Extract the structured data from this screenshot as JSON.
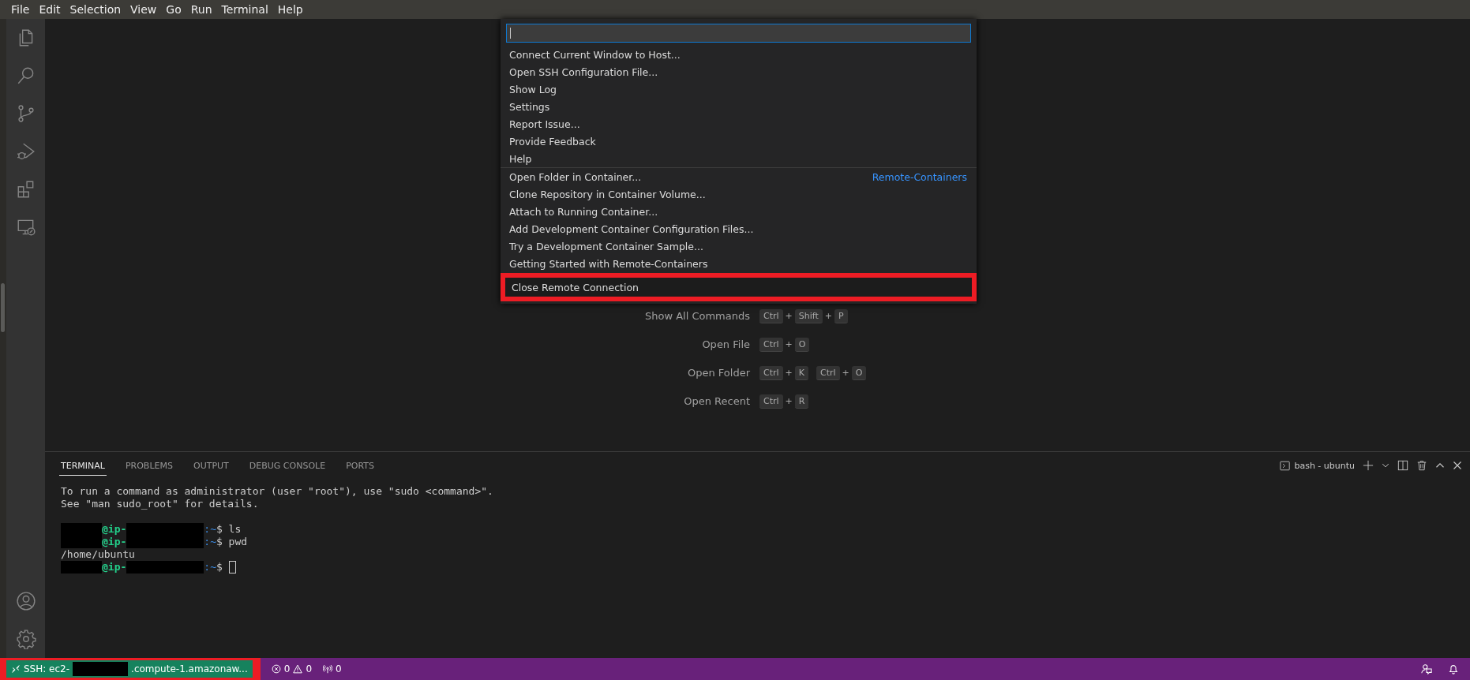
{
  "menu_bar": [
    "File",
    "Edit",
    "Selection",
    "View",
    "Go",
    "Run",
    "Terminal",
    "Help"
  ],
  "activity_bar": {
    "top": [
      {
        "kind": "files",
        "selected": false
      },
      {
        "kind": "search",
        "selected": false
      },
      {
        "kind": "source-control",
        "selected": false
      },
      {
        "kind": "run-debug",
        "selected": false
      },
      {
        "kind": "extensions",
        "selected": false
      },
      {
        "kind": "remote",
        "selected": false
      }
    ],
    "bottom": [
      {
        "kind": "account"
      },
      {
        "kind": "settings"
      }
    ]
  },
  "welcome_shortcuts": [
    {
      "label": "Show All Commands",
      "keys": [
        [
          "Ctrl",
          "Shift",
          "P"
        ]
      ]
    },
    {
      "label": "Open File",
      "keys": [
        [
          "Ctrl",
          "O"
        ]
      ]
    },
    {
      "label": "Open Folder",
      "keys": [
        [
          "Ctrl",
          "K"
        ],
        [
          "Ctrl",
          "O"
        ]
      ]
    },
    {
      "label": "Open Recent",
      "keys": [
        [
          "Ctrl",
          "R"
        ]
      ]
    }
  ],
  "key_joiner": "+",
  "quick_pick": {
    "focused": true,
    "groups": [
      {
        "items": [
          {
            "label": "Connect Current Window to Host...",
            "highlighted": false
          },
          {
            "label": "Open SSH Configuration File...",
            "highlighted": false
          },
          {
            "label": "Show Log",
            "highlighted": false
          },
          {
            "label": "Settings",
            "highlighted": false
          },
          {
            "label": "Report Issue...",
            "highlighted": false
          },
          {
            "label": "Provide Feedback",
            "highlighted": false
          },
          {
            "label": "Help",
            "highlighted": false
          }
        ]
      },
      {
        "label": "Remote-Containers",
        "items": [
          {
            "label": "Open Folder in Container...",
            "highlighted": false
          },
          {
            "label": "Clone Repository in Container Volume...",
            "highlighted": false
          },
          {
            "label": "Attach to Running Container...",
            "highlighted": false
          },
          {
            "label": "Add Development Container Configuration Files...",
            "highlighted": false
          },
          {
            "label": "Try a Development Container Sample...",
            "highlighted": false
          },
          {
            "label": "Getting Started with Remote-Containers",
            "highlighted": false
          },
          {
            "label": "Close Remote Connection",
            "highlighted": true
          }
        ]
      }
    ]
  },
  "panel": {
    "tabs": [
      {
        "label": "TERMINAL",
        "selected": true
      },
      {
        "label": "PROBLEMS",
        "selected": false
      },
      {
        "label": "OUTPUT",
        "selected": false
      },
      {
        "label": "DEBUG CONSOLE",
        "selected": false
      },
      {
        "label": "PORTS",
        "selected": false
      }
    ],
    "terminal_name": "bash - ubuntu",
    "terminal_lines": [
      {
        "kind": "text",
        "text": "To run a command as administrator (user \"root\"), use \"sudo <command>\"."
      },
      {
        "kind": "text",
        "text": "See \"man sudo_root\" for details."
      },
      {
        "kind": "blank"
      },
      {
        "kind": "prompt",
        "host": "@ip-",
        "path": ":~",
        "command": "$ ls"
      },
      {
        "kind": "prompt",
        "host": "@ip-",
        "path": ":~",
        "command": "$ pwd"
      },
      {
        "kind": "text",
        "text": "/home/ubuntu"
      },
      {
        "kind": "prompt",
        "host": "@ip-",
        "path": ":~",
        "command": "$",
        "cursor": true
      }
    ]
  },
  "status_bar": {
    "remote": {
      "prefix": "SSH: ec2-",
      "suffix": ".compute-1.amazonaw...",
      "highlighted": true
    },
    "errors": "0",
    "warnings": "0",
    "ports": "0"
  }
}
